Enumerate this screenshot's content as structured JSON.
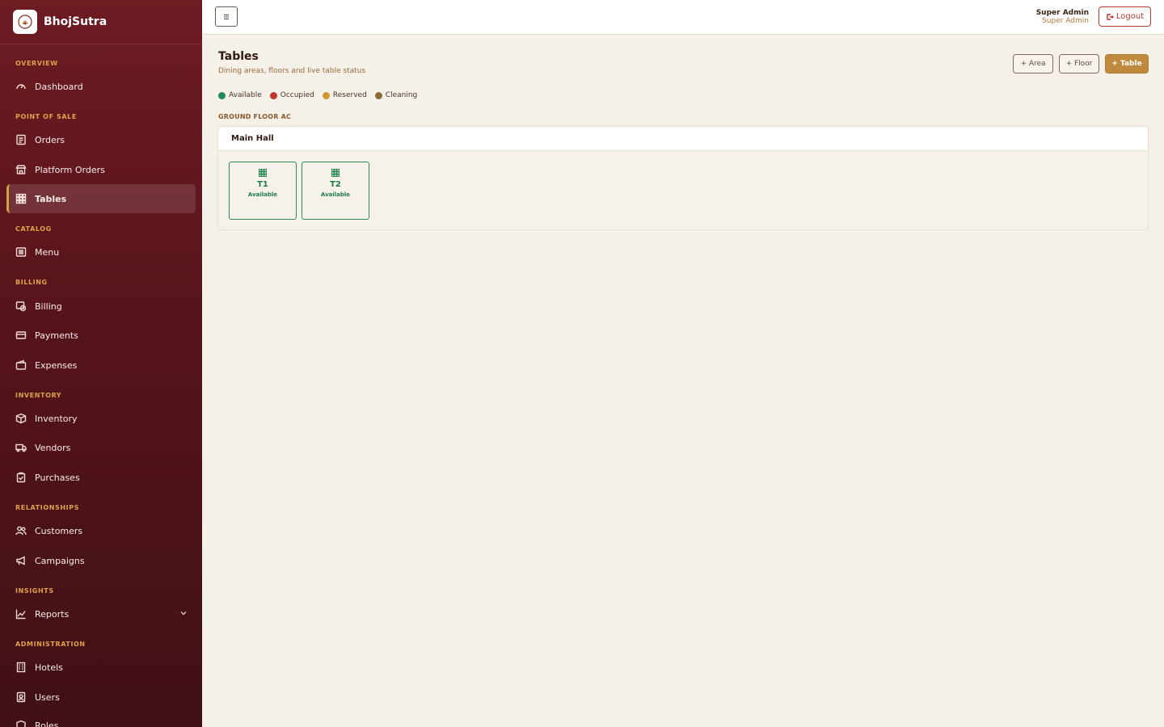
{
  "brand": {
    "name": "BhojSutra"
  },
  "sidebar": {
    "sections": {
      "overview": "OVERVIEW",
      "pos": "POINT OF SALE",
      "catalog": "CATALOG",
      "billing": "BILLING",
      "inventory": "INVENTORY",
      "relationships": "RELATIONSHIPS",
      "insights": "INSIGHTS",
      "administration": "ADMINISTRATION"
    },
    "items": {
      "dashboard": "Dashboard",
      "orders": "Orders",
      "platform_orders": "Platform Orders",
      "tables": "Tables",
      "menu": "Menu",
      "billing": "Billing",
      "payments": "Payments",
      "expenses": "Expenses",
      "inventory": "Inventory",
      "vendors": "Vendors",
      "purchases": "Purchases",
      "customers": "Customers",
      "campaigns": "Campaigns",
      "reports": "Reports",
      "hotels": "Hotels",
      "users": "Users",
      "roles": "Roles"
    },
    "active_item": "Tables"
  },
  "topbar": {
    "user_name": "Super Admin",
    "user_role": "Super Admin",
    "logout_label": "Logout"
  },
  "page": {
    "title": "Tables",
    "subtitle": "Dining areas, floors and live table status",
    "buttons": {
      "area": "+ Area",
      "floor": "+ Floor",
      "table": "+ Table"
    }
  },
  "legend": [
    {
      "label": "Available",
      "color": "#1e8a5a"
    },
    {
      "label": "Occupied",
      "color": "#c0392b"
    },
    {
      "label": "Reserved",
      "color": "#d4962e"
    },
    {
      "label": "Cleaning",
      "color": "#8a6a3a"
    }
  ],
  "floor": {
    "name": "GROUND FLOOR AC",
    "area": {
      "name": "Main Hall",
      "tables": [
        {
          "name": "T1",
          "status": "Available"
        },
        {
          "name": "T2",
          "status": "Available"
        }
      ]
    }
  },
  "colors": {
    "sidebar": "#6e1b22",
    "accent": "#c08a3e",
    "available": "#1e8a5a",
    "background": "#f5f0e8"
  }
}
